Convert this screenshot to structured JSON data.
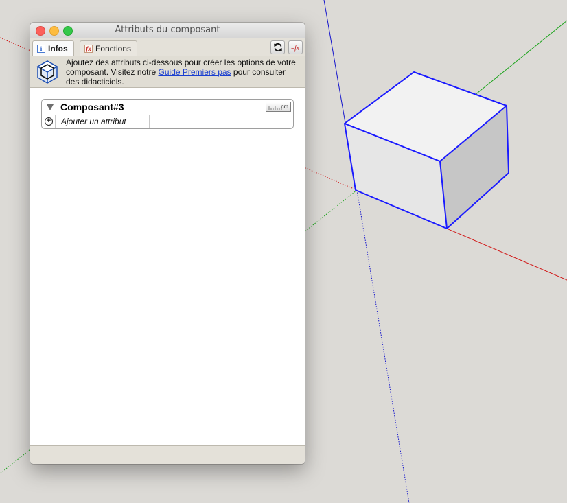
{
  "window": {
    "title": "Attributs du composant"
  },
  "tabs": [
    {
      "label": "Infos",
      "active": true,
      "icon": "info-icon"
    },
    {
      "label": "Fonctions",
      "active": false,
      "icon": "fx-icon"
    }
  ],
  "toolbar": {
    "refresh_icon": "refresh-icon",
    "formula_icon": "fx-formula-icon"
  },
  "infobar": {
    "text_before_link": "Ajoutez des attributs ci-dessous pour créer les options de votre composant. Visitez notre ",
    "link": "Guide Premiers pas",
    "text_after_link": " pour consulter des didacticiels."
  },
  "component": {
    "name": "Composant#3",
    "unit": "cm",
    "add_attribute_label": "Ajouter un attribut"
  },
  "colors": {
    "selection_edge": "#1a1aff",
    "axis_red": "#d11414",
    "axis_green": "#1aa31a",
    "axis_blue": "#1414cc",
    "link": "#1a3fd0"
  }
}
